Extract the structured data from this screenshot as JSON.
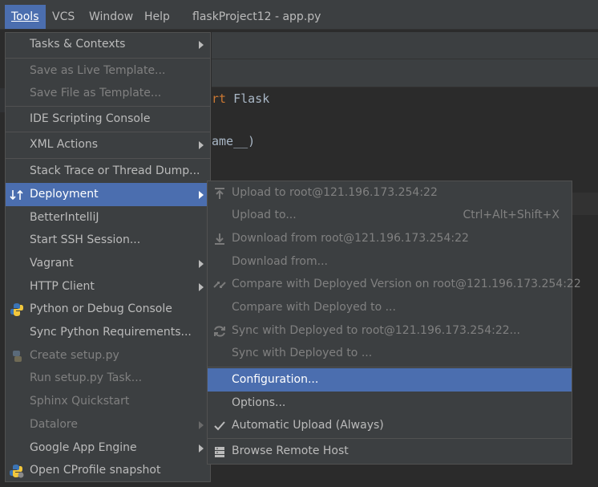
{
  "menubar": {
    "items": [
      "Tools",
      "VCS",
      "Window",
      "Help"
    ],
    "title": "flaskProject12 - app.py"
  },
  "editor": {
    "line1_kw": "rt",
    "line1_rest": " Flask",
    "line2": "ame__)"
  },
  "tools_menu": {
    "items": [
      {
        "label": "Tasks & Contexts"
      },
      {
        "label": "Save as Live Template..."
      },
      {
        "label": "Save File as Template..."
      },
      {
        "label": "IDE Scripting Console"
      },
      {
        "label": "XML Actions"
      },
      {
        "label": "Stack Trace or Thread Dump..."
      },
      {
        "label": "Deployment"
      },
      {
        "label": "BetterIntelliJ"
      },
      {
        "label": "Start SSH Session..."
      },
      {
        "label": "Vagrant"
      },
      {
        "label": "HTTP Client"
      },
      {
        "label": "Python or Debug Console"
      },
      {
        "label": "Sync Python Requirements..."
      },
      {
        "label": "Create setup.py"
      },
      {
        "label": "Run setup.py Task..."
      },
      {
        "label": "Sphinx Quickstart"
      },
      {
        "label": "Datalore"
      },
      {
        "label": "Google App Engine"
      },
      {
        "label": "Open CProfile snapshot"
      }
    ]
  },
  "deployment_submenu": {
    "items": [
      {
        "label": "Upload to root@121.196.173.254:22"
      },
      {
        "label": "Upload to...",
        "shortcut": "Ctrl+Alt+Shift+X"
      },
      {
        "label": "Download from root@121.196.173.254:22"
      },
      {
        "label": "Download from..."
      },
      {
        "label": "Compare with Deployed Version on root@121.196.173.254:22"
      },
      {
        "label": "Compare with Deployed to ..."
      },
      {
        "label": "Sync with Deployed to root@121.196.173.254:22..."
      },
      {
        "label": "Sync with Deployed to ..."
      },
      {
        "label": "Configuration..."
      },
      {
        "label": "Options..."
      },
      {
        "label": "Automatic Upload (Always)",
        "checked": true
      },
      {
        "label": "Browse Remote Host"
      }
    ]
  }
}
